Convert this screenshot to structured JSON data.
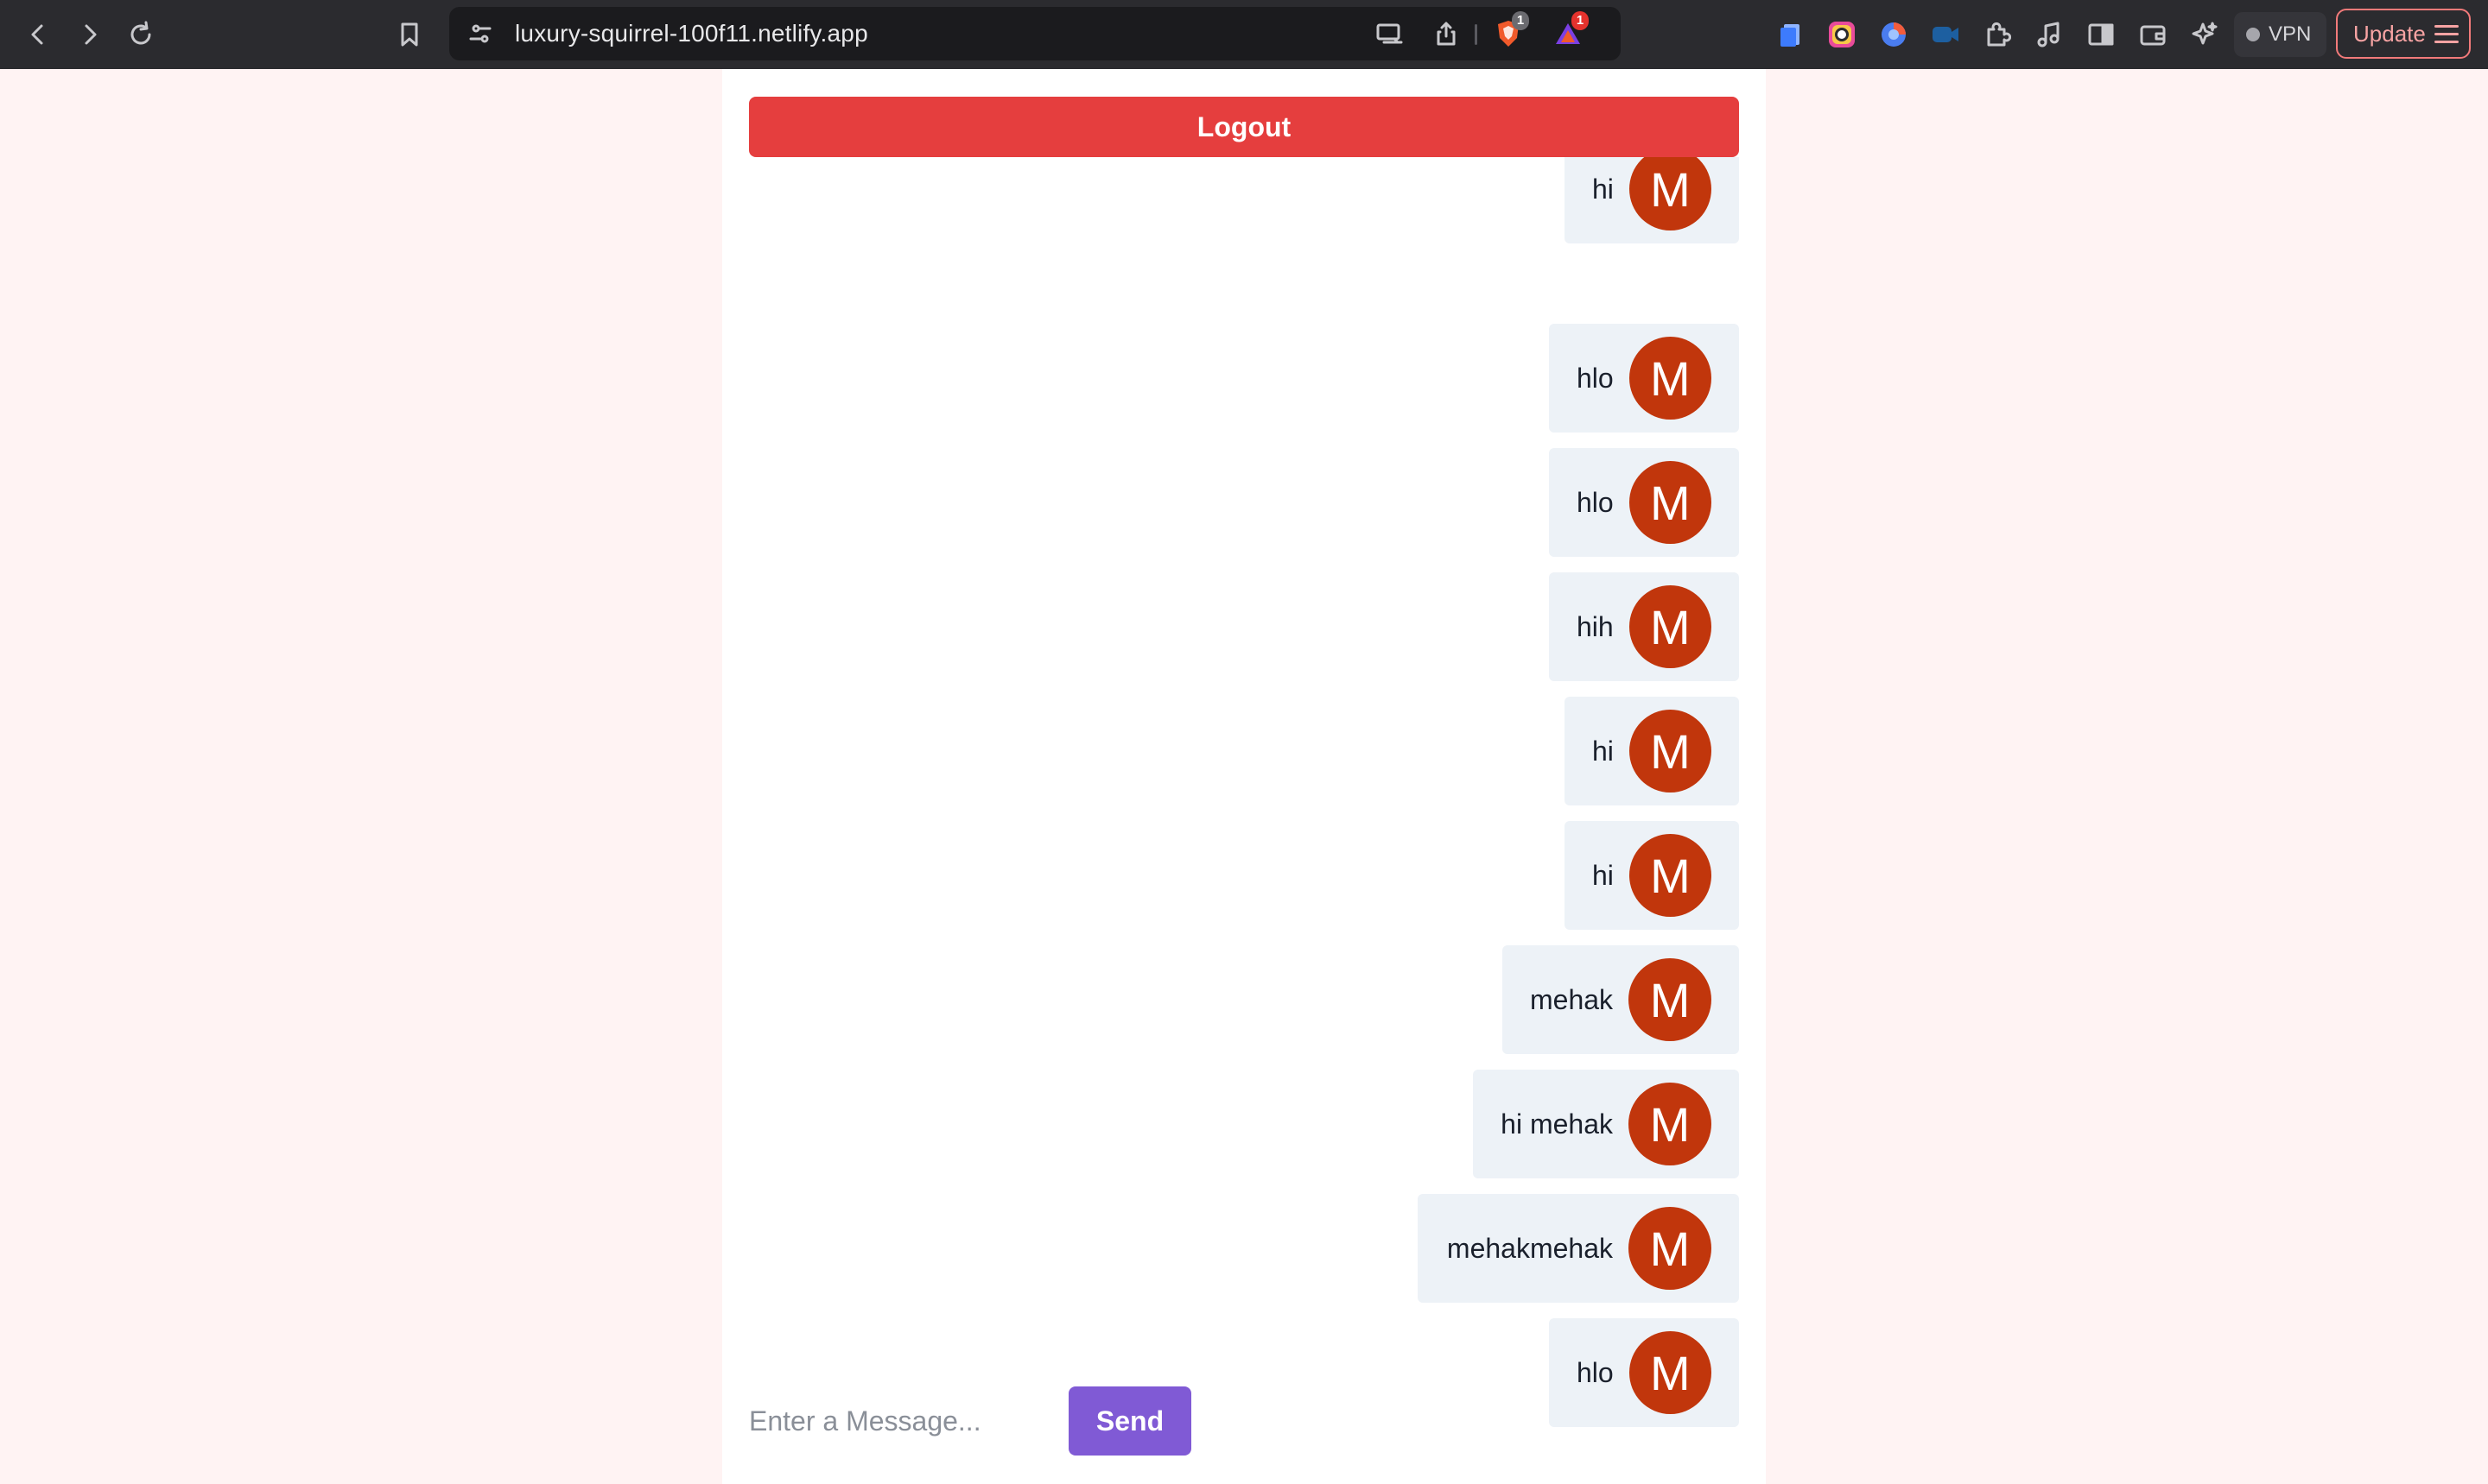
{
  "browser": {
    "url": "luxury-squirrel-100f11.netlify.app",
    "shield_badge": "1",
    "rewards_badge": "1",
    "vpn_label": "VPN",
    "update_label": "Update"
  },
  "chat": {
    "logout_label": "Logout",
    "messages": [
      {
        "text": "hi",
        "avatar": "M"
      },
      {
        "text": "hlo",
        "avatar": "M"
      },
      {
        "text": "hlo",
        "avatar": "M"
      },
      {
        "text": "hih",
        "avatar": "M"
      },
      {
        "text": "hi",
        "avatar": "M"
      },
      {
        "text": "hi",
        "avatar": "M"
      },
      {
        "text": "mehak",
        "avatar": "M"
      },
      {
        "text": "hi mehak",
        "avatar": "M"
      },
      {
        "text": "mehakmehak",
        "avatar": "M"
      },
      {
        "text": "hlo",
        "avatar": "M"
      }
    ],
    "input_placeholder": "Enter a Message...",
    "input_value": "",
    "send_label": "Send"
  },
  "colors": {
    "page_background": "#fff3f3",
    "logout_button": "#e53e3e",
    "send_button": "#805ad5",
    "avatar": "#c1360c",
    "message_bubble": "#edf2f7"
  }
}
